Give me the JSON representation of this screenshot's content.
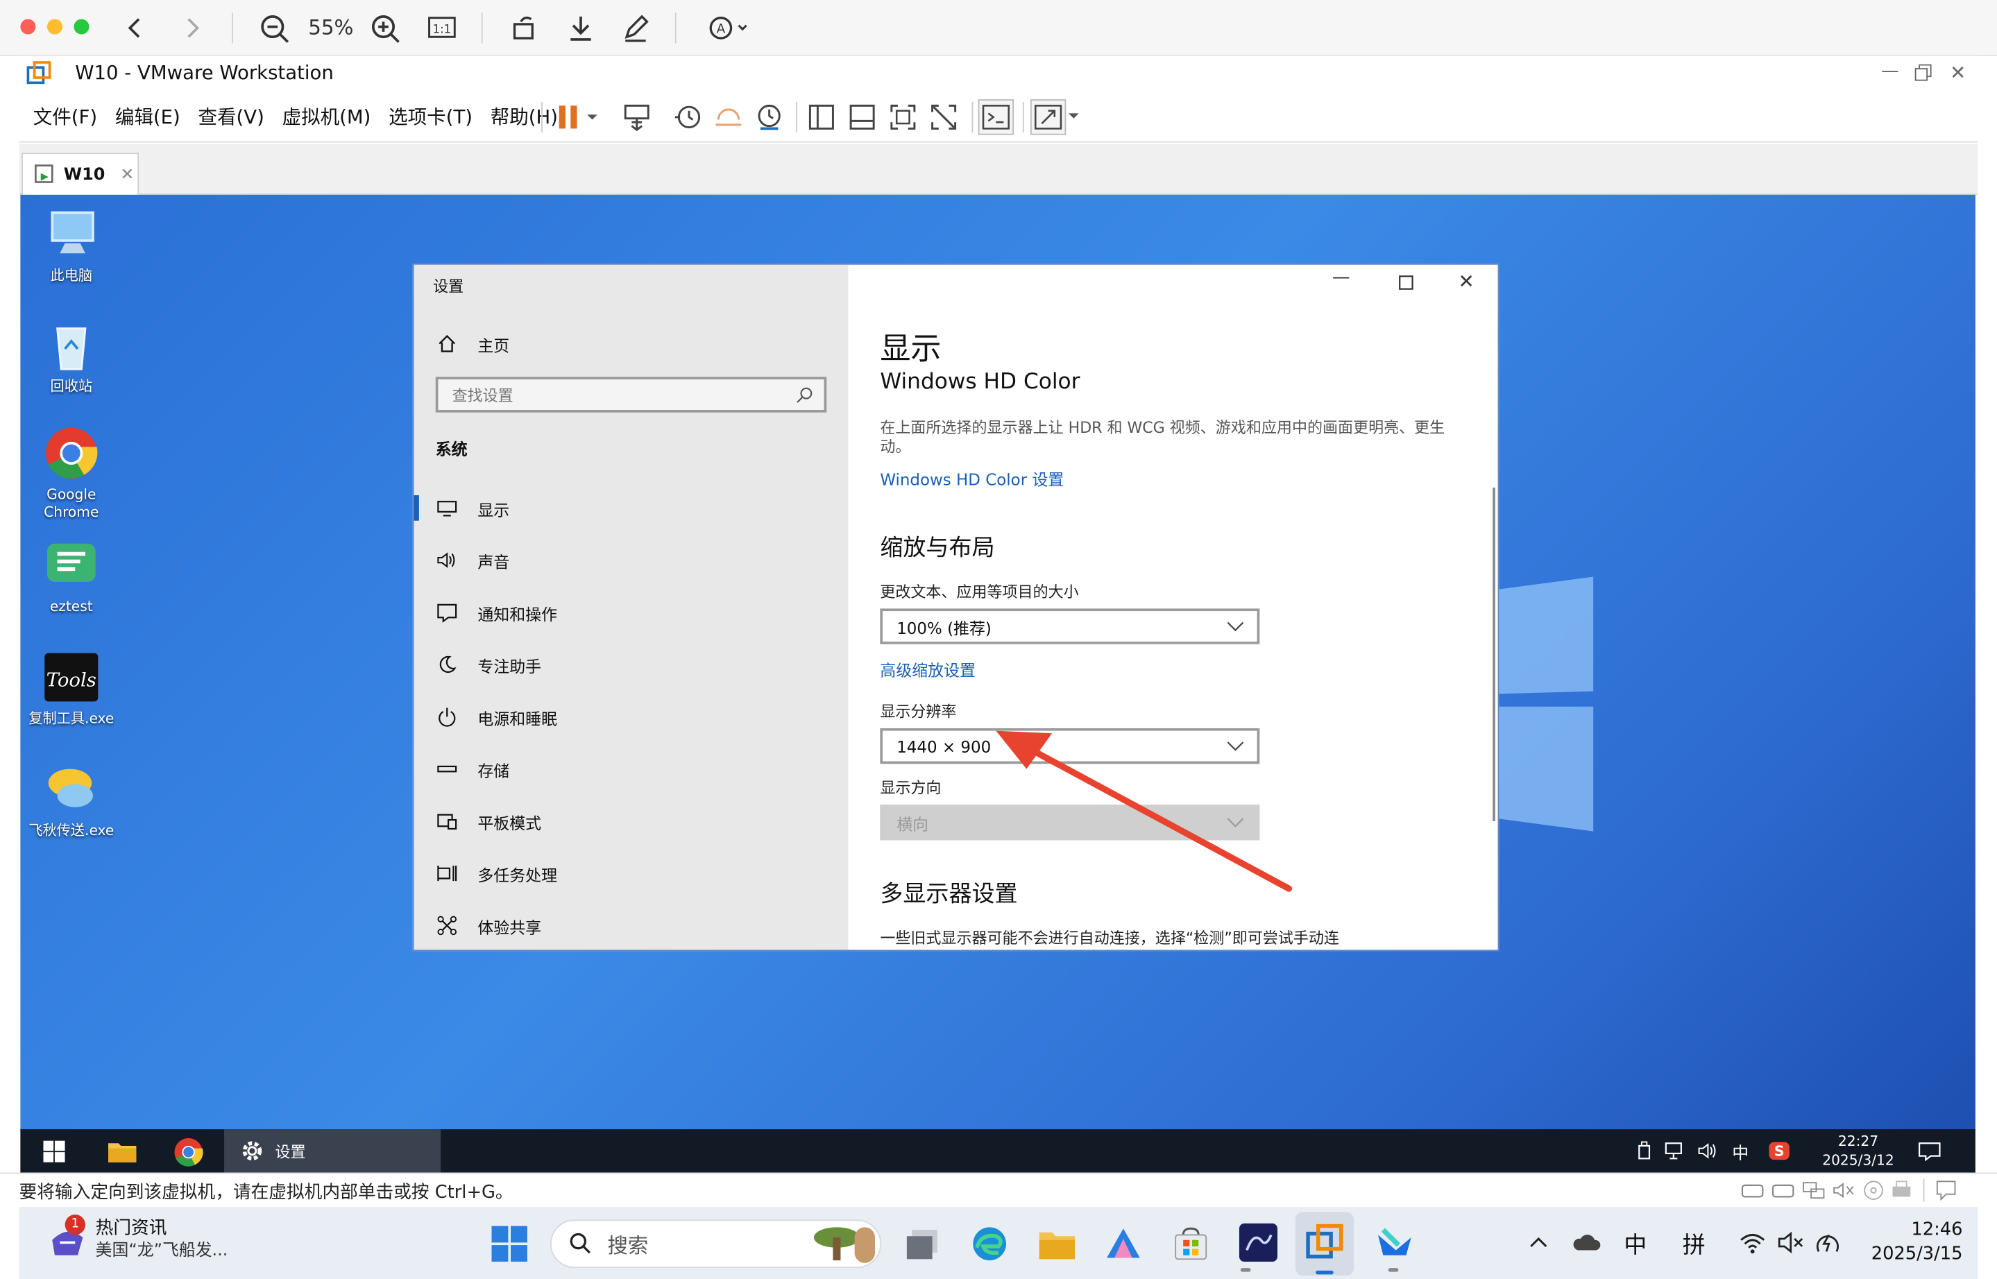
{
  "preview": {
    "zoom": "55%"
  },
  "vmware": {
    "title": "W10 - VMware Workstation",
    "menu": [
      "文件(F)",
      "编辑(E)",
      "查看(V)",
      "虚拟机(M)",
      "选项卡(T)",
      "帮助(H)"
    ],
    "tab": "W10",
    "status_message": "要将输入定向到该虚拟机，请在虚拟机内部单击或按 Ctrl+G。"
  },
  "desktop": {
    "icons": [
      {
        "label": "此电脑",
        "icon": "computer-icon"
      },
      {
        "label": "回收站",
        "icon": "recycle-bin-icon"
      },
      {
        "label": "Google Chrome",
        "icon": "chrome-icon"
      },
      {
        "label": "eztest",
        "icon": "eztest-icon"
      },
      {
        "label": "复制工具.exe",
        "icon": "tools-icon"
      },
      {
        "label": "飞秋传送.exe",
        "icon": "feiqiu-icon"
      }
    ]
  },
  "settings": {
    "window_title": "设置",
    "home": "主页",
    "search_placeholder": "查找设置",
    "section": "系统",
    "nav": [
      {
        "label": "显示",
        "icon": "monitor-icon",
        "active": true
      },
      {
        "label": "声音",
        "icon": "speaker-icon"
      },
      {
        "label": "通知和操作",
        "icon": "notification-icon"
      },
      {
        "label": "专注助手",
        "icon": "moon-icon"
      },
      {
        "label": "电源和睡眠",
        "icon": "power-icon"
      },
      {
        "label": "存储",
        "icon": "storage-icon"
      },
      {
        "label": "平板模式",
        "icon": "tablet-icon"
      },
      {
        "label": "多任务处理",
        "icon": "multitask-icon"
      },
      {
        "label": "体验共享",
        "icon": "share-icon"
      }
    ],
    "page_title": "显示",
    "hdr_title": "Windows HD Color",
    "hdr_desc": "在上面所选择的显示器上让 HDR 和 WCG 视频、游戏和应用中的画面更明亮、更生动。",
    "hdr_link": "Windows HD Color 设置",
    "scale_heading": "缩放与布局",
    "scale_label": "更改文本、应用等项目的大小",
    "scale_value": "100% (推荐)",
    "advanced_scale_link": "高级缩放设置",
    "resolution_label": "显示分辨率",
    "resolution_value": "1440 × 900",
    "orientation_label": "显示方向",
    "orientation_value": "横向",
    "multi_heading": "多显示器设置",
    "multi_desc": "一些旧式显示器可能不会进行自动连接，选择“检测”即可尝试手动连"
  },
  "guest_taskbar": {
    "active_app": "设置",
    "ime": "中",
    "time": "22:27",
    "date": "2025/3/12"
  },
  "host_taskbar": {
    "news_title": "热门资讯",
    "news_sub": "美国“龙”飞船发...",
    "news_badge": "1",
    "search_placeholder": "搜索",
    "ime1": "中",
    "ime2": "拼",
    "time": "12:46",
    "date": "2025/3/15"
  },
  "colors": {
    "accent": "#1a5fb4",
    "arrow": "#e8432f",
    "pause": "#e07020"
  }
}
